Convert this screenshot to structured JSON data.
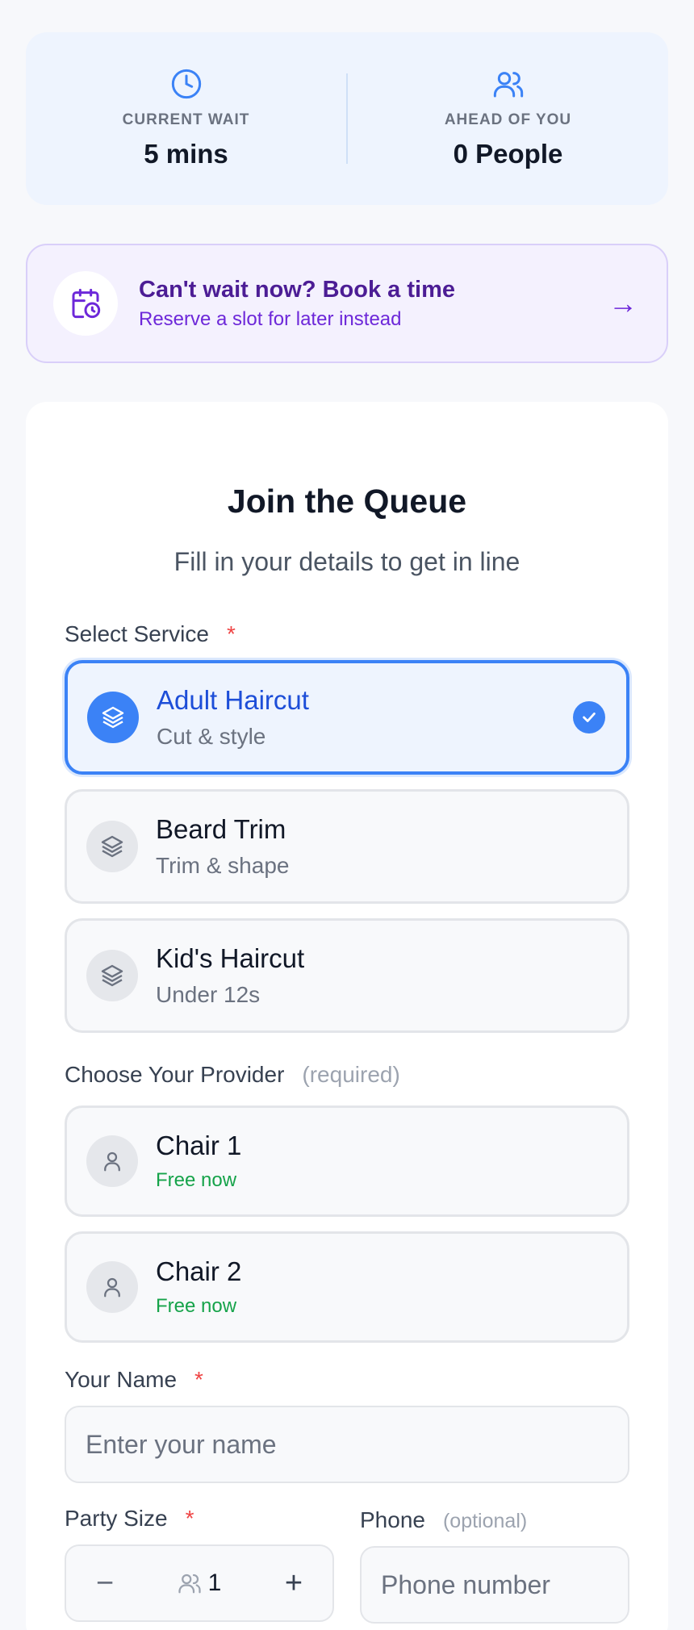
{
  "stats": {
    "wait_label": "CURRENT WAIT",
    "wait_value": "5 mins",
    "ahead_label": "AHEAD OF YOU",
    "ahead_value": "0 People"
  },
  "booking": {
    "title": "Can't wait now? Book a time",
    "subtitle": "Reserve a slot for later instead",
    "arrow": "→"
  },
  "form": {
    "title": "Join the Queue",
    "subtitle": "Fill in your details to get in line",
    "service_label": "Select Service",
    "required_mark": "*",
    "services": [
      {
        "name": "Adult Haircut",
        "desc": "Cut & style",
        "selected": true
      },
      {
        "name": "Beard Trim",
        "desc": "Trim & shape",
        "selected": false
      },
      {
        "name": "Kid's Haircut",
        "desc": "Under 12s",
        "selected": false
      }
    ],
    "provider_label": "Choose Your Provider",
    "provider_hint": "(required)",
    "providers": [
      {
        "name": "Chair 1",
        "status": "Free now"
      },
      {
        "name": "Chair 2",
        "status": "Free now"
      }
    ],
    "name_label": "Your Name",
    "name_placeholder": "Enter your name",
    "party_label": "Party Size",
    "party_value": "1",
    "party_minus": "−",
    "party_plus": "+",
    "phone_label": "Phone",
    "phone_hint": "(optional)",
    "phone_placeholder": "Phone number"
  },
  "colors": {
    "accent": "#3b82f6",
    "purple": "#6d28d9",
    "success": "#16a34a",
    "required": "#ef4444"
  }
}
